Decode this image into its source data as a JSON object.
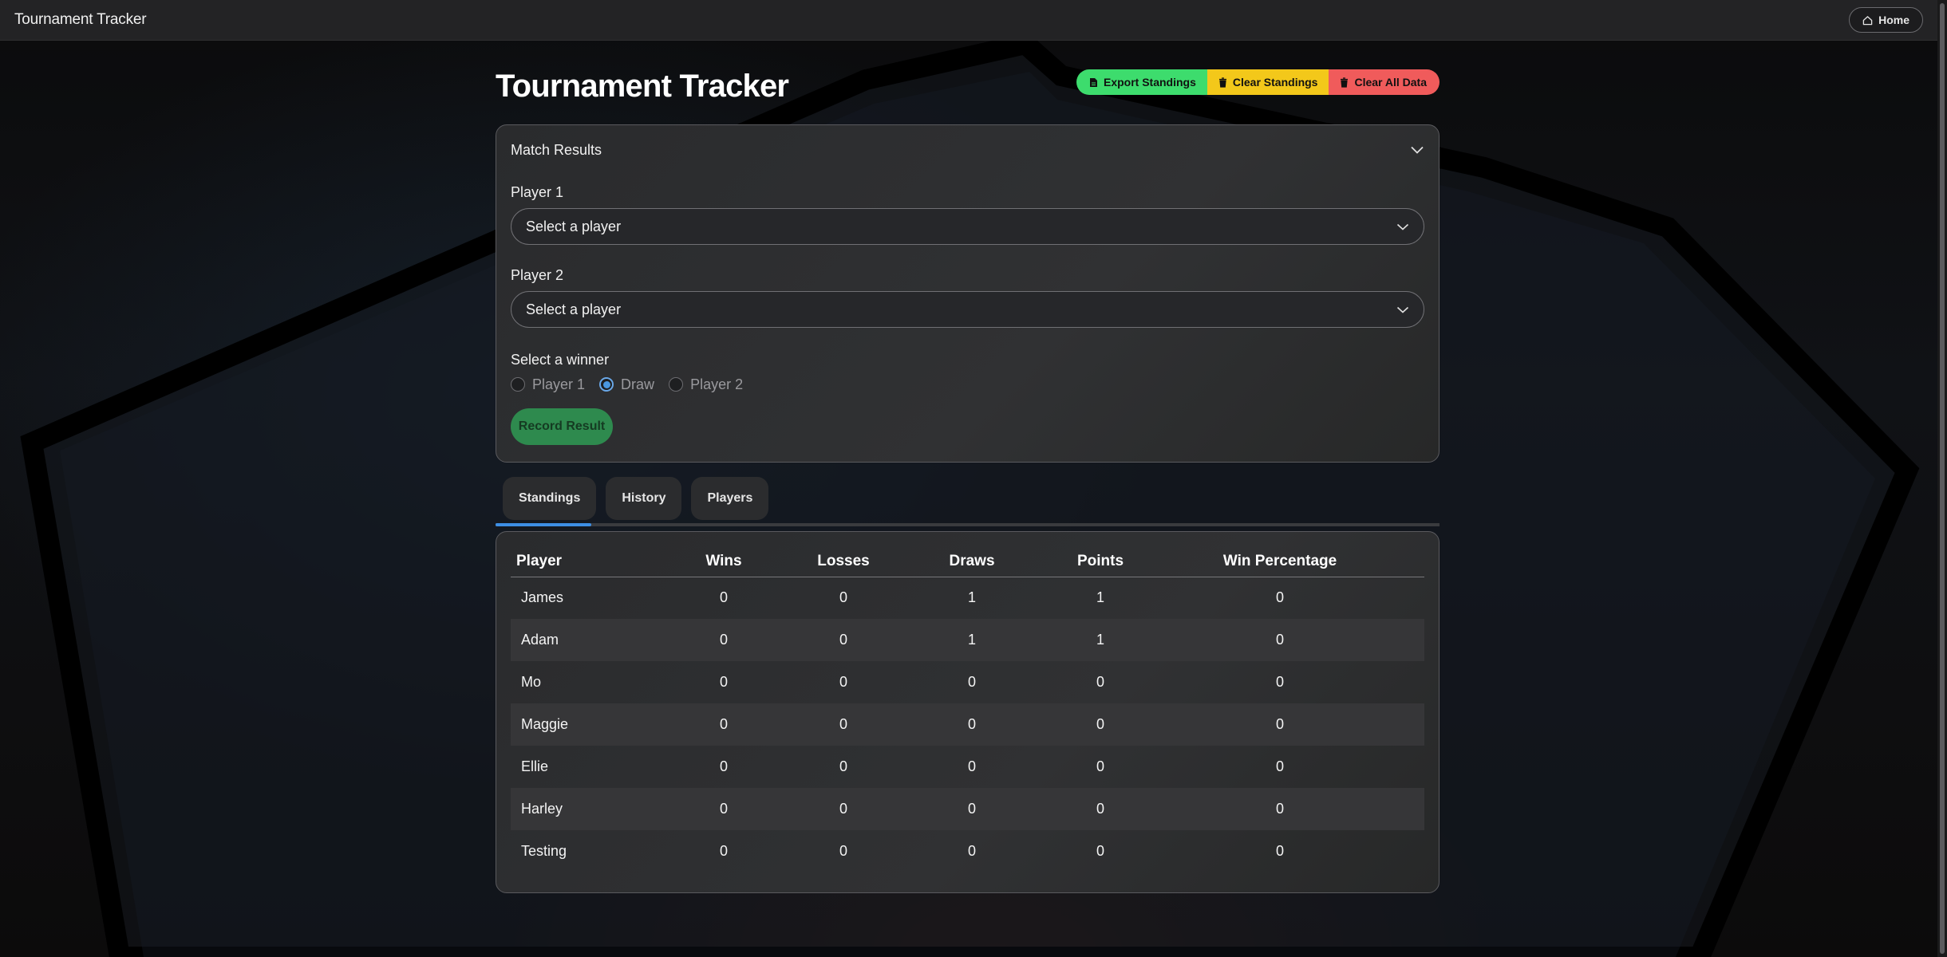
{
  "app": {
    "brand": "Tournament Tracker",
    "home_label": "Home"
  },
  "page": {
    "title": "Tournament Tracker",
    "actions": {
      "export": "Export Standings",
      "clear_standings": "Clear Standings",
      "clear_all": "Clear All Data"
    }
  },
  "match": {
    "title": "Match Results",
    "player1_label": "Player 1",
    "player1_value": "Select a player",
    "player2_label": "Player 2",
    "player2_value": "Select a player",
    "winner_label": "Select a winner",
    "options": [
      "Player 1",
      "Draw",
      "Player 2"
    ],
    "selected": "Draw",
    "record_label": "Record Result"
  },
  "tabs": [
    "Standings",
    "History",
    "Players"
  ],
  "active_tab": "Standings",
  "standings": {
    "columns": [
      "Player",
      "Wins",
      "Losses",
      "Draws",
      "Points",
      "Win Percentage"
    ],
    "rows": [
      [
        "James",
        "0",
        "0",
        "1",
        "1",
        "0"
      ],
      [
        "Adam",
        "0",
        "0",
        "1",
        "1",
        "0"
      ],
      [
        "Mo",
        "0",
        "0",
        "0",
        "0",
        "0"
      ],
      [
        "Maggie",
        "0",
        "0",
        "0",
        "0",
        "0"
      ],
      [
        "Ellie",
        "0",
        "0",
        "0",
        "0",
        "0"
      ],
      [
        "Harley",
        "0",
        "0",
        "0",
        "0",
        "0"
      ],
      [
        "Testing",
        "0",
        "0",
        "0",
        "0",
        "0"
      ]
    ]
  },
  "colors": {
    "export": "#3ddc6d",
    "clear_standings": "#f3c81a",
    "clear_all": "#f05b5b",
    "record": "#2e8a4e",
    "tab_active": "#3d8fe6"
  },
  "icons": {
    "home": "home-icon",
    "export": "file-icon",
    "clear": "trash-icon",
    "chevron": "chevron-down-icon"
  }
}
